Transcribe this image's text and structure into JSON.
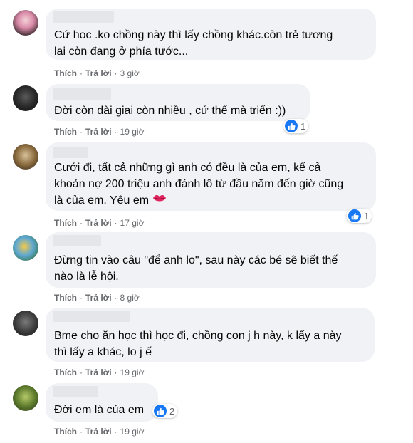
{
  "comments": [
    {
      "lines": [
        "Cứ hoc .ko chồng này thì lấy chồng khác.còn trẻ tương",
        "lai còn đang ở phía tước..."
      ],
      "like": "Thích",
      "reply": "Trả lời",
      "time": "3 giờ",
      "reactions": ""
    },
    {
      "lines": [
        "Đời còn dài giai còn nhiều , cứ thế mà triển :))"
      ],
      "like": "Thích",
      "reply": "Trả lời",
      "time": "19 giờ",
      "reactions": "1"
    },
    {
      "lines": [
        "Cưới đi, tất cả những gì anh có đều là của em, kể cả",
        "khoản nợ 200 triệu anh đánh lô từ đầu năm đến giờ cũng",
        "là của em. Yêu em"
      ],
      "like": "Thích",
      "reply": "Trả lời",
      "time": "17 giờ",
      "reactions": "1"
    },
    {
      "lines": [
        "Đừng tin vào câu \"để anh lo\", sau này các bé sẽ biết thế",
        "nào là lễ hội."
      ],
      "like": "Thích",
      "reply": "Trả lời",
      "time": "8 giờ",
      "reactions": ""
    },
    {
      "lines": [
        "Bme cho ăn học thì học đi, chồng con j h này, k lấy a này",
        "thì lấy a khác, lo j ế"
      ],
      "like": "Thích",
      "reply": "Trả lời",
      "time": "19 giờ",
      "reactions": ""
    },
    {
      "lines": [
        "Đời em là của em"
      ],
      "like": "Thích",
      "reply": "Trả lời",
      "time": "19 giờ",
      "reactions": "2"
    }
  ],
  "colors": {
    "bubble": "#f0f2f5",
    "like_blue": "#1877f2",
    "meta_gray": "#65676b"
  },
  "icons": [
    "like-icon",
    "kiss-lips-icon"
  ]
}
